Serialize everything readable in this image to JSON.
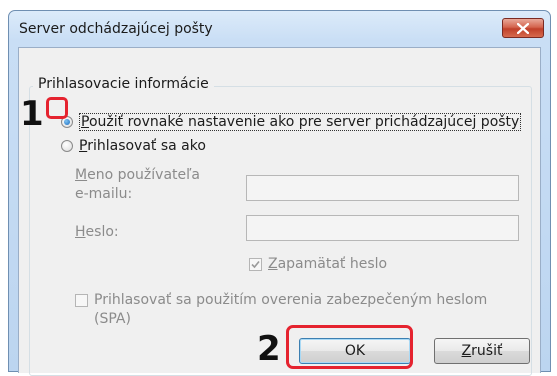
{
  "window": {
    "title": "Server odchádzajúcej pošty"
  },
  "group": {
    "legend": "Prihlasovacie informácie"
  },
  "options": {
    "use_same": {
      "label_accel": "P",
      "label_rest": "oužiť rovnaké nastavenie ako pre server prichádzajúcej pošty",
      "checked": true
    },
    "login_as": {
      "label_accel": "P",
      "label_rest": "rihlasovať sa ako",
      "checked": false
    }
  },
  "fields": {
    "username": {
      "label_accel": "M",
      "label_line1_rest": "eno používateľa",
      "label_line2": "e-mailu:",
      "value": ""
    },
    "password": {
      "label_accel": "H",
      "label_rest": "eslo:",
      "value": ""
    }
  },
  "checkboxes": {
    "remember": {
      "label_accel": "Z",
      "label_rest": "apamätať heslo",
      "checked": true
    },
    "spa": {
      "label_line1": "Prihlasovať sa použitím overenia zabezpečeným heslom",
      "label_line2": "(SPA)",
      "checked": false
    }
  },
  "buttons": {
    "ok": "OK",
    "cancel_accel": "Z",
    "cancel_rest": "rušiť"
  },
  "annotations": {
    "step1": "1",
    "step2": "2",
    "highlight_color": "#e5232f"
  }
}
